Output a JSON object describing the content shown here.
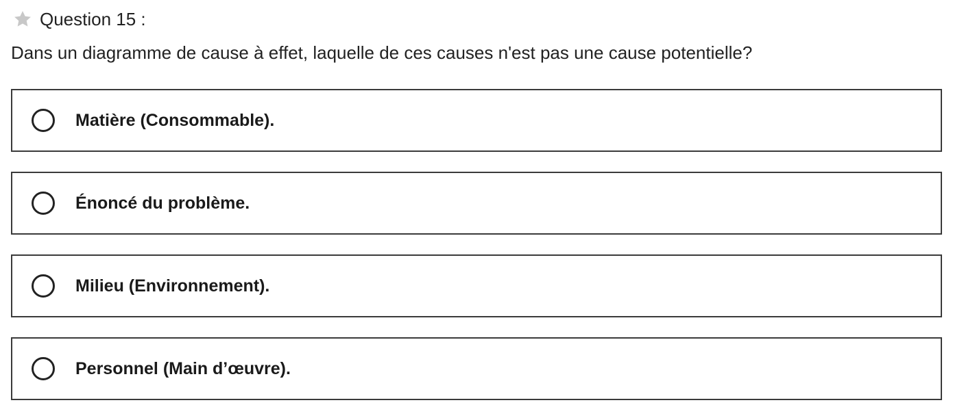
{
  "question": {
    "label": "Question 15 :",
    "icon": "star-icon",
    "icon_color": "#c8c8c8",
    "prompt": "Dans un diagramme de cause à effet, laquelle de ces causes n'est pas une cause potentielle?"
  },
  "options": [
    {
      "label": "Matière (Consommable).",
      "selected": false
    },
    {
      "label": "Énoncé du problème.",
      "selected": false
    },
    {
      "label": "Milieu (Environnement).",
      "selected": false
    },
    {
      "label": "Personnel (Main d’œuvre).",
      "selected": false
    }
  ]
}
